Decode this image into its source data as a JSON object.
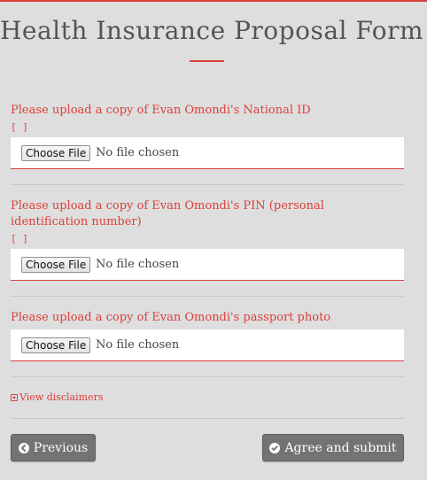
{
  "form": {
    "title": "Health Insurance Proposal Form"
  },
  "uploads": [
    {
      "label": "Please upload a copy of Evan Omondi's National ID",
      "brackets": "[ ]",
      "button_label": "Choose File",
      "status": "No file chosen"
    },
    {
      "label": "Please upload a copy of Evan Omondi's PIN (personal identification number)",
      "brackets": "[ ]",
      "button_label": "Choose File",
      "status": "No file chosen"
    },
    {
      "label": "Please upload a copy of Evan Omondi's passport photo",
      "button_label": "Choose File",
      "status": "No file chosen"
    }
  ],
  "disclaimer": {
    "label": "View disclaimers"
  },
  "nav": {
    "previous_label": "Previous",
    "submit_label": "Agree and submit"
  },
  "colors": {
    "accent": "#d9403b",
    "background": "#dedede",
    "button": "#737373"
  }
}
